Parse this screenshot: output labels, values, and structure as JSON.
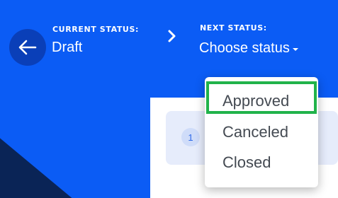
{
  "header": {
    "back_icon": "arrow-left-icon",
    "current_status_label": "CURRENT STATUS:",
    "current_status_value": "Draft",
    "separator_icon": "chevron-right-icon",
    "next_status_label": "NEXT STATUS:",
    "next_status_value": "Choose status",
    "caret_icon": "caret-down-icon"
  },
  "step": {
    "number": "1"
  },
  "dropdown": {
    "options": [
      {
        "label": "Approved",
        "highlighted": true
      },
      {
        "label": "Canceled"
      },
      {
        "label": "Closed"
      }
    ]
  },
  "colors": {
    "background": "#0b5cf5",
    "dark_wedge": "#0a2456",
    "back_button": "#0a3fb8",
    "highlight": "#21b34a",
    "card": "#e6ecfb"
  }
}
